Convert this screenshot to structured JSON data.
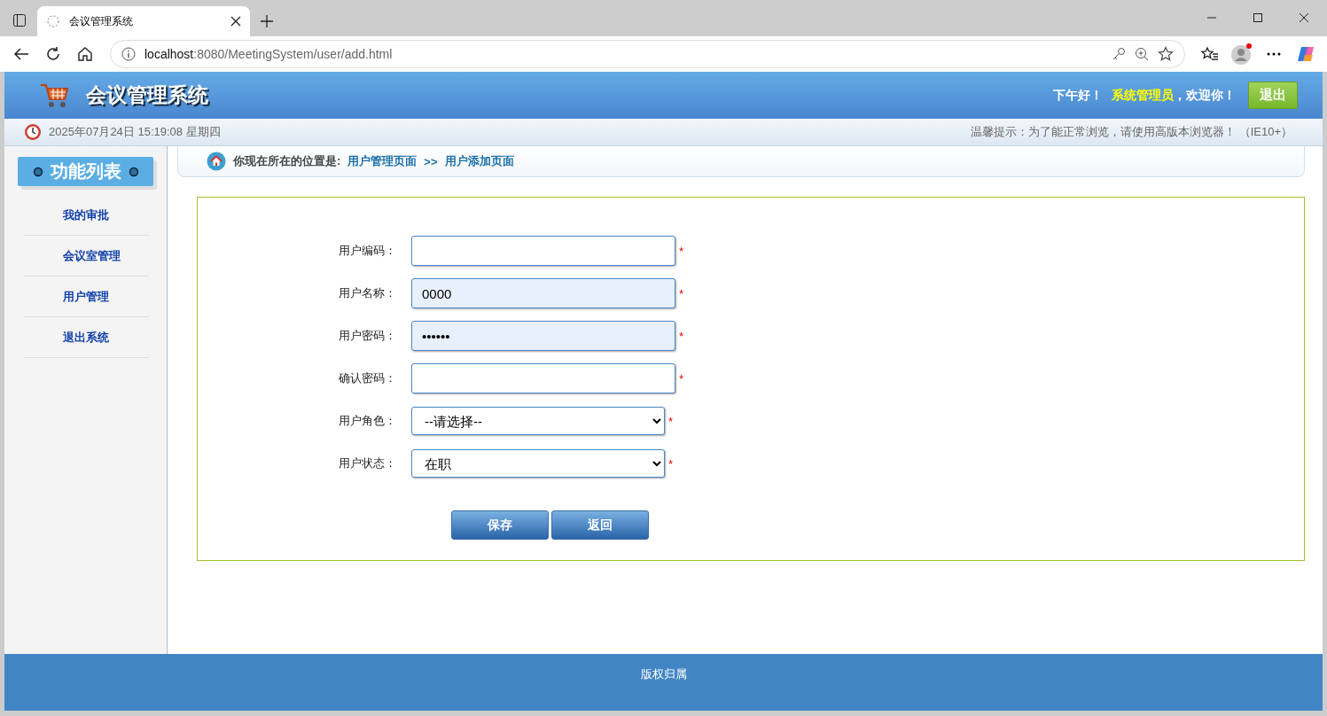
{
  "browser": {
    "tab_title": "会议管理系统",
    "url_host": "localhost",
    "url_path": ":8080/MeetingSystem/user/add.html"
  },
  "header": {
    "title": "会议管理系统",
    "greeting": "下午好！",
    "user": "系统管理员",
    "welcome": "，欢迎你！",
    "logout": "退出"
  },
  "info_bar": {
    "datetime": "2025年07月24日 15:19:08 星期四",
    "tip": "温馨提示：为了能正常浏览，请使用高版本浏览器！ （IE10+）"
  },
  "sidebar": {
    "title": "功能列表",
    "items": [
      {
        "label": "我的审批"
      },
      {
        "label": "会议室管理"
      },
      {
        "label": "用户管理"
      },
      {
        "label": "退出系统"
      }
    ]
  },
  "breadcrumb": {
    "prefix": "你现在所在的位置是:",
    "path": [
      "用户管理页面",
      "用户添加页面"
    ],
    "separator": ">>"
  },
  "form": {
    "fields": [
      {
        "label": "用户编码：",
        "kind": "text",
        "required": true,
        "autofilled": false
      },
      {
        "label": "用户名称：",
        "kind": "text",
        "value": "0000",
        "required": true,
        "autofilled": true
      },
      {
        "label": "用户密码：",
        "kind": "password",
        "value": "••••••",
        "required": true,
        "autofilled": true
      },
      {
        "label": "确认密码：",
        "kind": "password",
        "required": true,
        "autofilled": false
      },
      {
        "label": "用户角色：",
        "kind": "select",
        "value": "--请选择--",
        "required": true
      },
      {
        "label": "用户状态：",
        "kind": "select",
        "value": "在职",
        "required": true
      }
    ],
    "required_mark": "*",
    "buttons": [
      {
        "label": "保存"
      },
      {
        "label": "返回"
      }
    ]
  },
  "footer": {
    "text": "版权归属"
  }
}
